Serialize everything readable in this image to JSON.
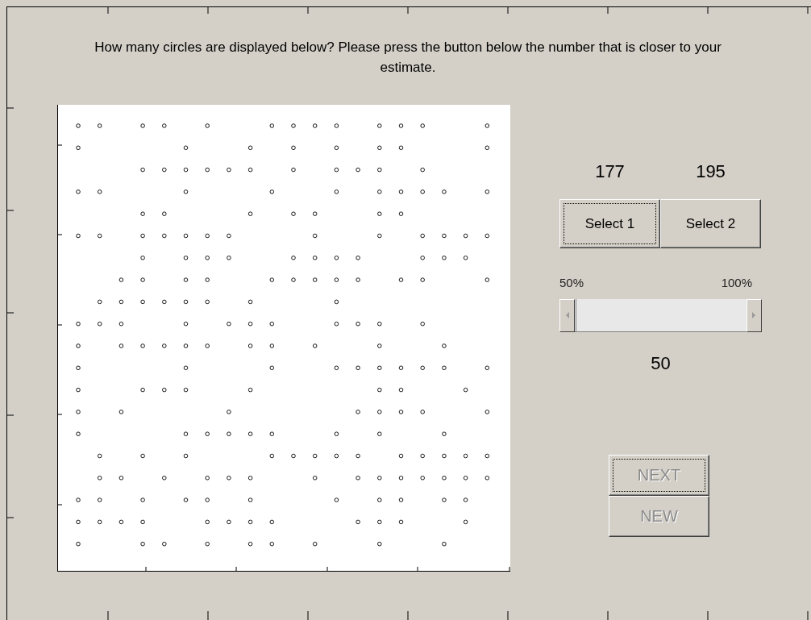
{
  "prompt": "How many circles are displayed below? Please press the button below the number that is closer to your estimate.",
  "choices": [
    {
      "number": "177",
      "button": "Select 1",
      "focused": true
    },
    {
      "number": "195",
      "button": "Select 2",
      "focused": false
    }
  ],
  "slider": {
    "min_label": "50%",
    "max_label": "100%",
    "level": 0,
    "reading": "50"
  },
  "buttons": [
    {
      "label": "NEXT",
      "disabled": true,
      "focused": true
    },
    {
      "label": "NEW",
      "disabled": true,
      "focused": false
    }
  ]
}
